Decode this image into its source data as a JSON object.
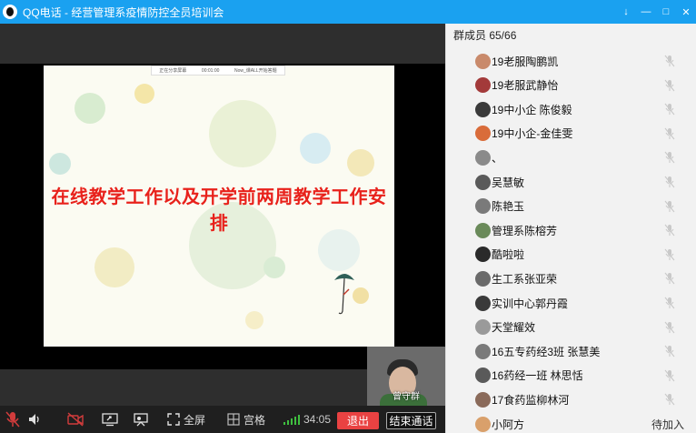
{
  "window": {
    "title": "QQ电话 - 经营管理系疫情防控全员培训会",
    "controls": [
      "↓",
      "—",
      "□",
      "✕"
    ]
  },
  "slide": {
    "topbar_items": [
      "正在分享屏幕",
      "00:01:00",
      "Now_课ALL开始答题"
    ],
    "heading": "在线教学工作以及开学前两周教学工作安排"
  },
  "self_view": {
    "name": "曾守群"
  },
  "toolbar": {
    "fullscreen_label": "全屏",
    "grid_label": "宫格",
    "timer": "34:05",
    "exit_label": "退出",
    "end_call_label": "结束通话"
  },
  "members_panel": {
    "header": "群成员 65/66",
    "members": [
      {
        "name": "19老服陶鹏凯",
        "avatar_color": "#c98a6b"
      },
      {
        "name": "19老服武静怡",
        "avatar_color": "#a33a3a"
      },
      {
        "name": "19中小企  陈俊毅",
        "avatar_color": "#3a3a3a"
      },
      {
        "name": "19中小企-金佳雯",
        "avatar_color": "#d96c3a"
      },
      {
        "name": "、",
        "avatar_color": "#8a8a8a"
      },
      {
        "name": "吴慧敏",
        "avatar_color": "#5a5a5a"
      },
      {
        "name": "陈艳玉",
        "avatar_color": "#7a7a7a"
      },
      {
        "name": "管理系陈榕芳",
        "avatar_color": "#6a8a5a"
      },
      {
        "name": "酷啦啦",
        "avatar_color": "#2a2a2a"
      },
      {
        "name": "生工系张亚荣",
        "avatar_color": "#6a6a6a"
      },
      {
        "name": "实训中心郭丹霞",
        "avatar_color": "#3a3a3a"
      },
      {
        "name": "天堂耀效",
        "avatar_color": "#9a9a9a"
      },
      {
        "name": "16五专药经3班 张慧美",
        "avatar_color": "#7a7a7a"
      },
      {
        "name": "16药经一班 林思恬",
        "avatar_color": "#5a5a5a"
      },
      {
        "name": "17食药监柳林河",
        "avatar_color": "#8a6a5a"
      },
      {
        "name": "小阿方",
        "avatar_color": "#d9a06b",
        "status": "待加入"
      }
    ]
  },
  "colors": {
    "titlebar": "#1aa1f0",
    "heading_red": "#e8211b",
    "exit_button": "#e94242",
    "signal_green": "#3fbf3f"
  }
}
